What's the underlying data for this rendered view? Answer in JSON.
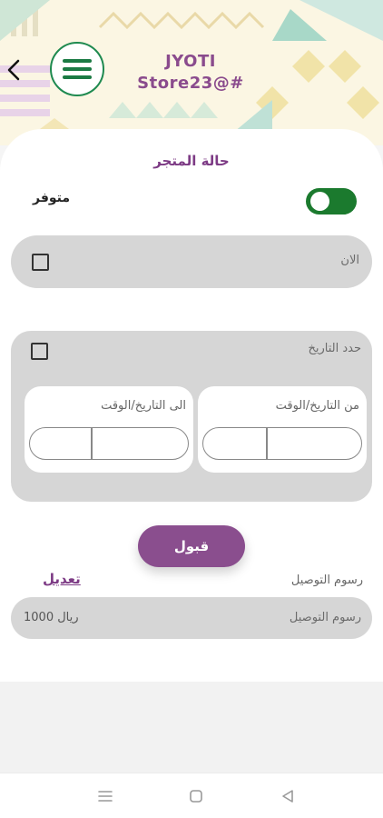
{
  "header": {
    "store_name_line1": "JYOTI",
    "store_name_line2": "Store23@#"
  },
  "store_status": {
    "title": "حالة المتجر",
    "availability_label": "متوفر",
    "availability_on": true
  },
  "now_option": {
    "label": "الان",
    "checked": false
  },
  "date_range": {
    "label": "حدد التاريخ",
    "checked": false,
    "from_label": "من التاريخ/الوقت",
    "to_label": "الى التاريخ/الوقت"
  },
  "actions": {
    "accept_label": "قبول"
  },
  "delivery_fee": {
    "edit_label": "تعديل",
    "section_label": "رسوم التوصيل",
    "field_placeholder": "رسوم التوصيل",
    "value": "1000 ريال"
  },
  "colors": {
    "brand_purple": "#8a4e8e",
    "toggle_green": "#1b7a2e",
    "menu_green": "#1b7a43"
  },
  "icons": {
    "back": "chevron-left-icon",
    "menu": "hamburger-icon",
    "nav_recent": "recent-apps-icon",
    "nav_home": "home-icon",
    "nav_back": "back-triangle-icon"
  }
}
